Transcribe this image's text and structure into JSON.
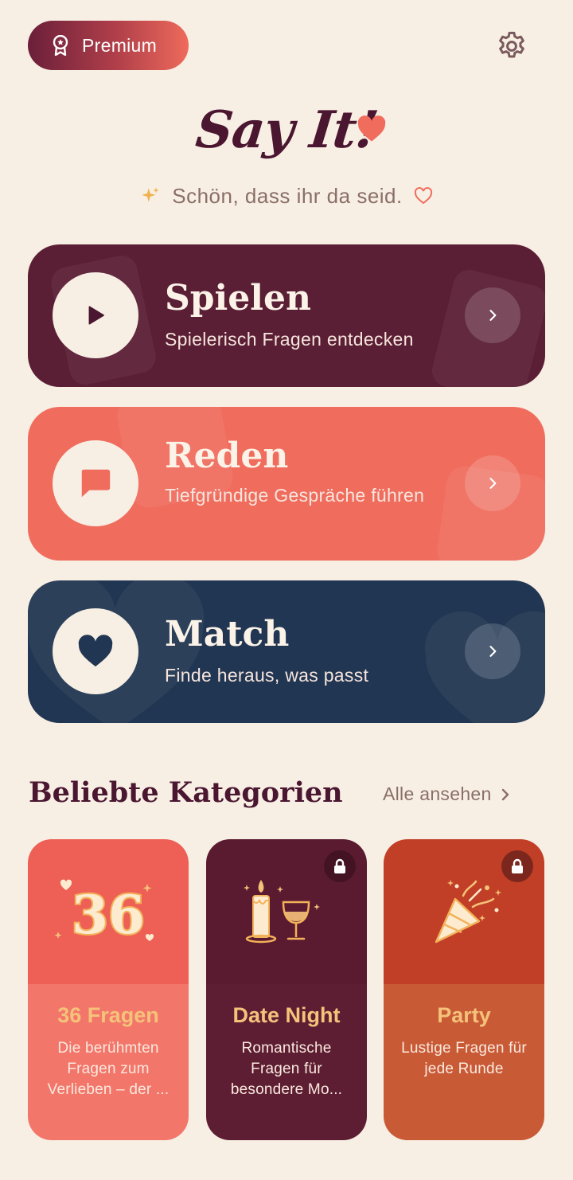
{
  "header": {
    "premium_label": "Premium",
    "settings_icon": "gear-icon"
  },
  "logo": {
    "text": "Say It!"
  },
  "tagline": "Schön, dass ihr da seid.",
  "modes": [
    {
      "title": "Spielen",
      "subtitle": "Spielerisch Fragen entdecken",
      "icon": "play-icon",
      "color": "#5a1e35"
    },
    {
      "title": "Reden",
      "subtitle": "Tiefgründige Gespräche führen",
      "icon": "chat-bubble-icon",
      "color": "#f06d5e"
    },
    {
      "title": "Match",
      "subtitle": "Finde heraus, was passt",
      "icon": "heart-icon",
      "color": "#213652"
    }
  ],
  "categories_section": {
    "title": "Beliebte Kategorien",
    "see_all": "Alle ansehen",
    "items": [
      {
        "title": "36 Fragen",
        "desc": "Die berühmten Fragen zum Verlieben – der ...",
        "badge": "36",
        "locked": false
      },
      {
        "title": "Date Night",
        "desc": "Romantische Fragen für besondere Mo...",
        "locked": true
      },
      {
        "title": "Party",
        "desc": "Lustige Fragen für jede Runde",
        "locked": true
      }
    ]
  },
  "colors": {
    "background": "#f8efe4",
    "primary_dark": "#4a1630",
    "accent": "#f06d5e",
    "gold": "#f5c27a"
  }
}
